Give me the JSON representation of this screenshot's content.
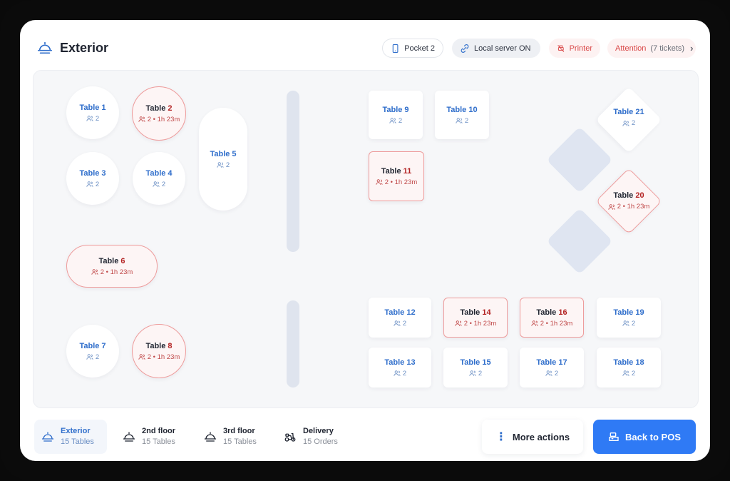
{
  "header": {
    "title": "Exterior",
    "pocket": "Pocket 2",
    "server": "Local server ON",
    "printer": "Printer",
    "attention": "Attention",
    "attention_count": "(7 tickets)"
  },
  "colors": {
    "accent": "#2f7af5",
    "busy": "#b32222",
    "free": "#2f6ecb"
  },
  "tables": [
    {
      "id": "1",
      "label": "Table 1",
      "guests": "2",
      "busy": false
    },
    {
      "id": "2",
      "label": "Table 2",
      "guests": "2 • 1h 23m",
      "busy": true
    },
    {
      "id": "3",
      "label": "Table 3",
      "guests": "2",
      "busy": false
    },
    {
      "id": "4",
      "label": "Table 4",
      "guests": "2",
      "busy": false
    },
    {
      "id": "5",
      "label": "Table 5",
      "guests": "2",
      "busy": false
    },
    {
      "id": "6",
      "label": "Table 6",
      "guests": "2 • 1h 23m",
      "busy": true
    },
    {
      "id": "7",
      "label": "Table 7",
      "guests": "2",
      "busy": false
    },
    {
      "id": "8",
      "label": "Table 8",
      "guests": "2 • 1h 23m",
      "busy": true
    },
    {
      "id": "9",
      "label": "Table 9",
      "guests": "2",
      "busy": false
    },
    {
      "id": "10",
      "label": "Table 10",
      "guests": "2",
      "busy": false
    },
    {
      "id": "11",
      "label": "Table 11",
      "guests": "2 • 1h 23m",
      "busy": true
    },
    {
      "id": "12",
      "label": "Table 12",
      "guests": "2",
      "busy": false
    },
    {
      "id": "13",
      "label": "Table 13",
      "guests": "2",
      "busy": false
    },
    {
      "id": "14",
      "label": "Table 14",
      "guests": "2 • 1h 23m",
      "busy": true
    },
    {
      "id": "15",
      "label": "Table 15",
      "guests": "2",
      "busy": false
    },
    {
      "id": "16",
      "label": "Table 16",
      "guests": "2 • 1h 23m",
      "busy": true
    },
    {
      "id": "17",
      "label": "Table 17",
      "guests": "2",
      "busy": false
    },
    {
      "id": "18",
      "label": "Table 18",
      "guests": "2",
      "busy": false
    },
    {
      "id": "19",
      "label": "Table 19",
      "guests": "2",
      "busy": false
    },
    {
      "id": "20",
      "label": "Table 20",
      "guests": "2 • 1h 23m",
      "busy": true
    },
    {
      "id": "21",
      "label": "Table 21",
      "guests": "2",
      "busy": false
    }
  ],
  "tabs": [
    {
      "label": "Exterior",
      "sub": "15 Tables"
    },
    {
      "label": "2nd floor",
      "sub": "15 Tables"
    },
    {
      "label": "3rd floor",
      "sub": "15 Tables"
    },
    {
      "label": "Delivery",
      "sub": "15 Orders"
    }
  ],
  "actions": {
    "more": "More actions",
    "back": "Back to POS"
  }
}
